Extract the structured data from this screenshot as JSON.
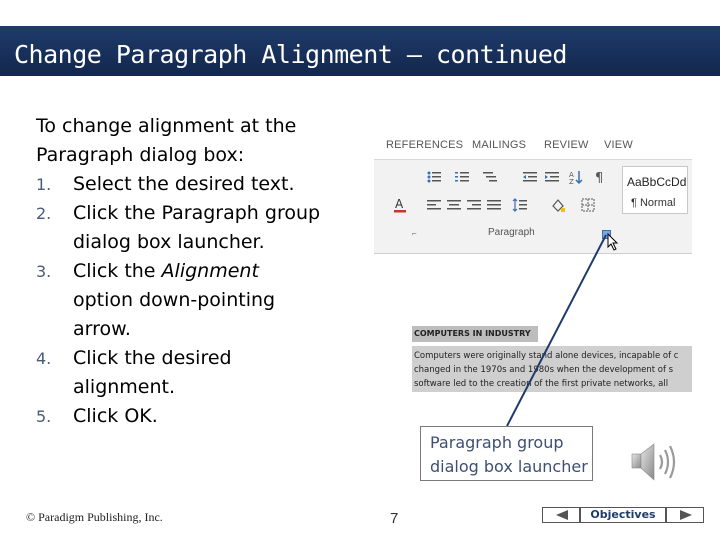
{
  "slide": {
    "title": "Change Paragraph Alignment – continued",
    "intro_line1": "To change alignment at the",
    "intro_line2": "Paragraph dialog box:",
    "steps": [
      {
        "num": "1.",
        "line1": "Select the desired text."
      },
      {
        "num": "2.",
        "line1": "Click the Paragraph group",
        "line2": "dialog box launcher."
      },
      {
        "num": "3.",
        "line1_pre": "Click the ",
        "line1_italic": "Alignment",
        "line2": "option down-pointing",
        "line3": "arrow."
      },
      {
        "num": "4.",
        "line1": "Click the desired",
        "line2": "alignment."
      },
      {
        "num": "5.",
        "line1": "Click OK."
      }
    ]
  },
  "ribbon": {
    "tabs": [
      "REFERENCES",
      "MAILINGS",
      "REVIEW",
      "VIEW"
    ],
    "style_sample": "AaBbCcDd",
    "style_name": "¶ Normal",
    "group_label": "Paragraph",
    "small_launcher_glyph": "⌐"
  },
  "document": {
    "heading": "COMPUTERS IN INDUSTRY",
    "lines": [
      "Computers were originally stand alone devices, incapable of c",
      "changed in the 1970s and 1980s when the development of s",
      "software led to the creation of the first private networks, all"
    ]
  },
  "callout": {
    "line1": "Paragraph group",
    "line2": "dialog box launcher"
  },
  "footer": {
    "copyright": "© Paradigm Publishing, Inc.",
    "page_number": "7",
    "objectives_label": "Objectives"
  },
  "colors": {
    "title_bar": "#1f3b6b",
    "callout_text": "#3d4f72",
    "launcher": "#7aa7e0"
  }
}
